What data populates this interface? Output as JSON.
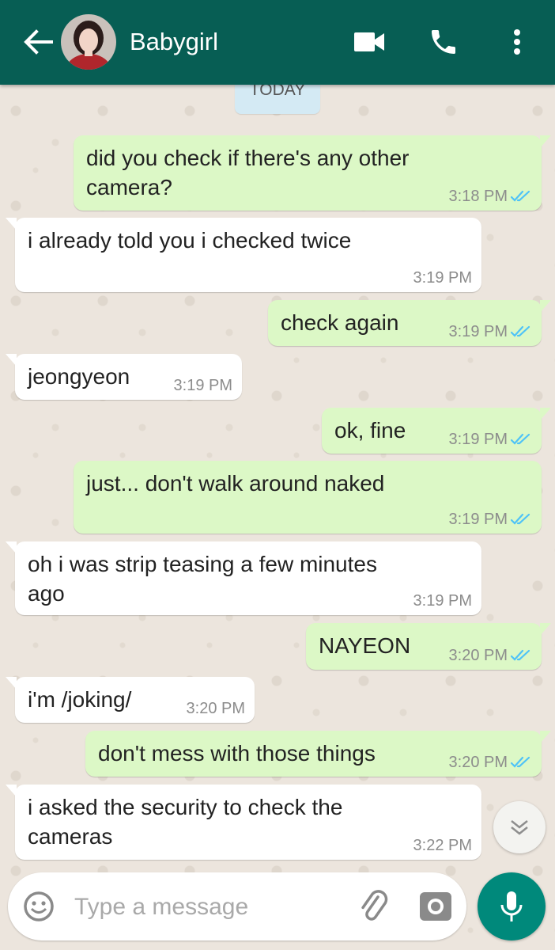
{
  "header": {
    "contact_name": "Babygirl",
    "color": "#075e54",
    "icons": [
      "back-arrow-icon",
      "video-call-icon",
      "phone-icon",
      "more-options-icon"
    ]
  },
  "date_chip": "TODAY",
  "messages": [
    {
      "dir": "out",
      "lines": [
        "did you check if there's any other",
        "camera?"
      ],
      "time": "3:18 PM",
      "ticks": "read"
    },
    {
      "dir": "in",
      "lines": [
        "i already told you i checked twice"
      ],
      "time": "3:19 PM"
    },
    {
      "dir": "out",
      "lines": [
        "check again"
      ],
      "time": "3:19 PM",
      "ticks": "read"
    },
    {
      "dir": "in",
      "lines": [
        "jeongyeon"
      ],
      "time": "3:19 PM"
    },
    {
      "dir": "out",
      "lines": [
        "ok, fine"
      ],
      "time": "3:19 PM",
      "ticks": "read"
    },
    {
      "dir": "out",
      "lines": [
        "just... don't walk around naked"
      ],
      "time": "3:19 PM",
      "ticks": "read"
    },
    {
      "dir": "in",
      "lines": [
        "oh i was strip teasing a few minutes",
        "ago"
      ],
      "time": "3:19 PM"
    },
    {
      "dir": "out",
      "lines": [
        "NAYEON"
      ],
      "time": "3:20 PM",
      "ticks": "read"
    },
    {
      "dir": "in",
      "lines": [
        "i'm /joking/"
      ],
      "time": "3:20 PM"
    },
    {
      "dir": "out",
      "lines": [
        "don't mess with those things"
      ],
      "time": "3:20 PM",
      "ticks": "read"
    },
    {
      "dir": "in",
      "lines": [
        "i asked the security to check the",
        "cameras"
      ],
      "time": "3:22 PM"
    }
  ],
  "composer": {
    "placeholder": "Type a message",
    "icons": [
      "emoji-icon",
      "attach-icon",
      "camera-icon",
      "mic-icon"
    ]
  },
  "colors": {
    "outgoing_bubble": "#dcf8c6",
    "incoming_bubble": "#ffffff",
    "read_ticks": "#4fc3f7",
    "wallpaper": "#ece5dd",
    "mic_button": "#00897b"
  }
}
